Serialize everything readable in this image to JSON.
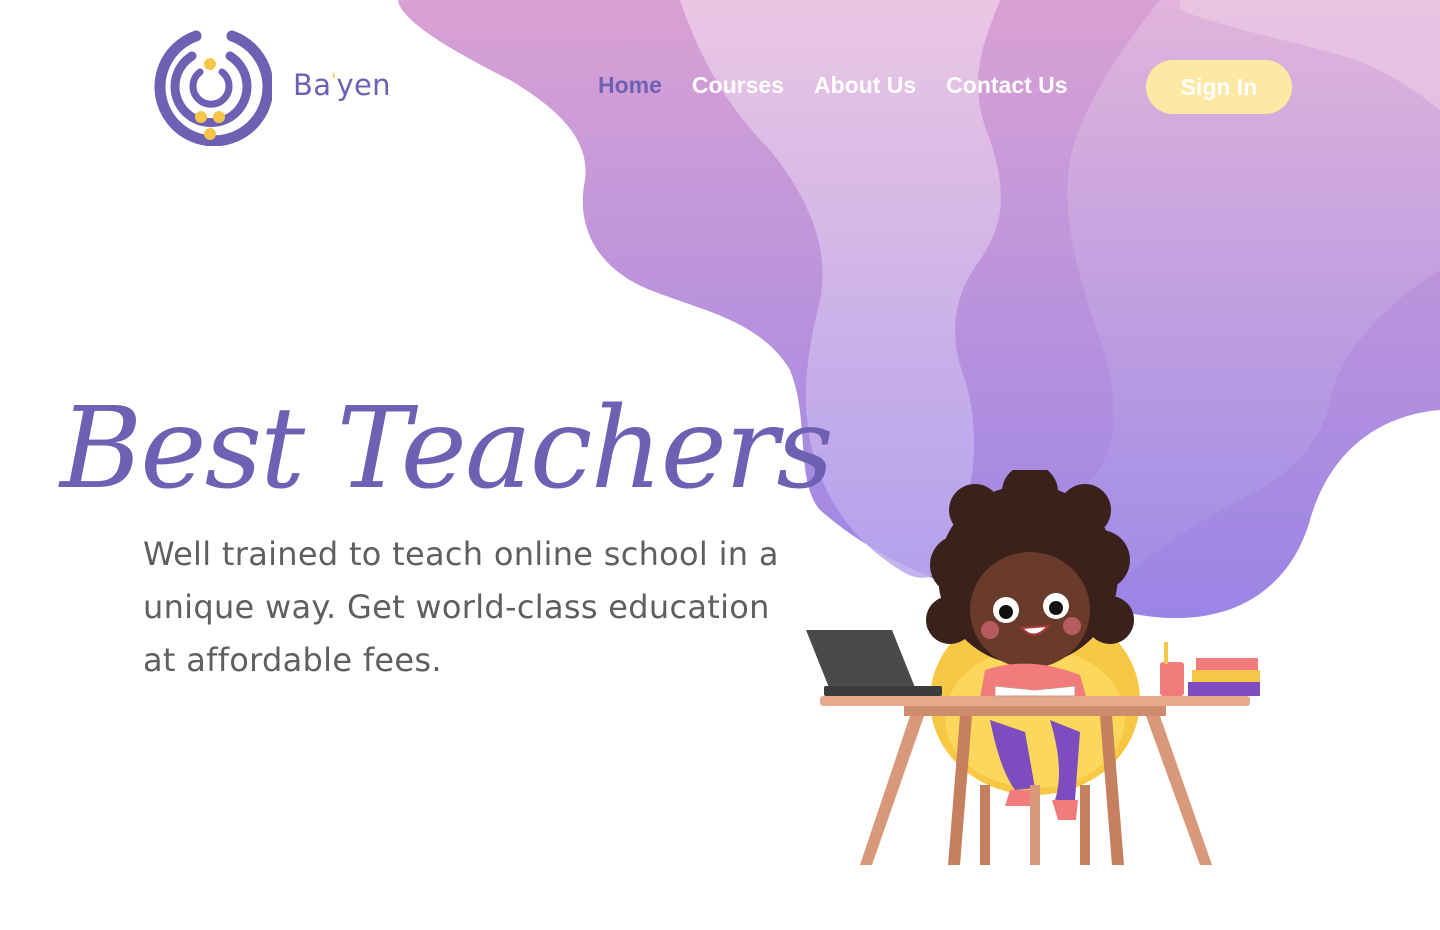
{
  "header": {
    "brand": {
      "prefix": "Ba",
      "mark": "'",
      "suffix": "yen"
    },
    "nav": [
      {
        "label": "Home",
        "active": true
      },
      {
        "label": "Courses",
        "active": false
      },
      {
        "label": "About Us",
        "active": false
      },
      {
        "label": "Contact Us",
        "active": false
      }
    ],
    "signin_label": "Sign In"
  },
  "hero": {
    "title": "Best Teachers",
    "description": "Well trained to teach online school in a unique way. Get world-class education at affordable fees."
  },
  "colors": {
    "brand_purple": "#6e61b4",
    "accent_yellow": "#f5c64a",
    "signin_bg": "#fde9a4",
    "wave_light": "#e7c4e0",
    "wave_dark": "#9a82e4"
  },
  "icons": {
    "logo": "brand-logo-icon",
    "illustration": "girl-studying-at-desk-illustration"
  }
}
